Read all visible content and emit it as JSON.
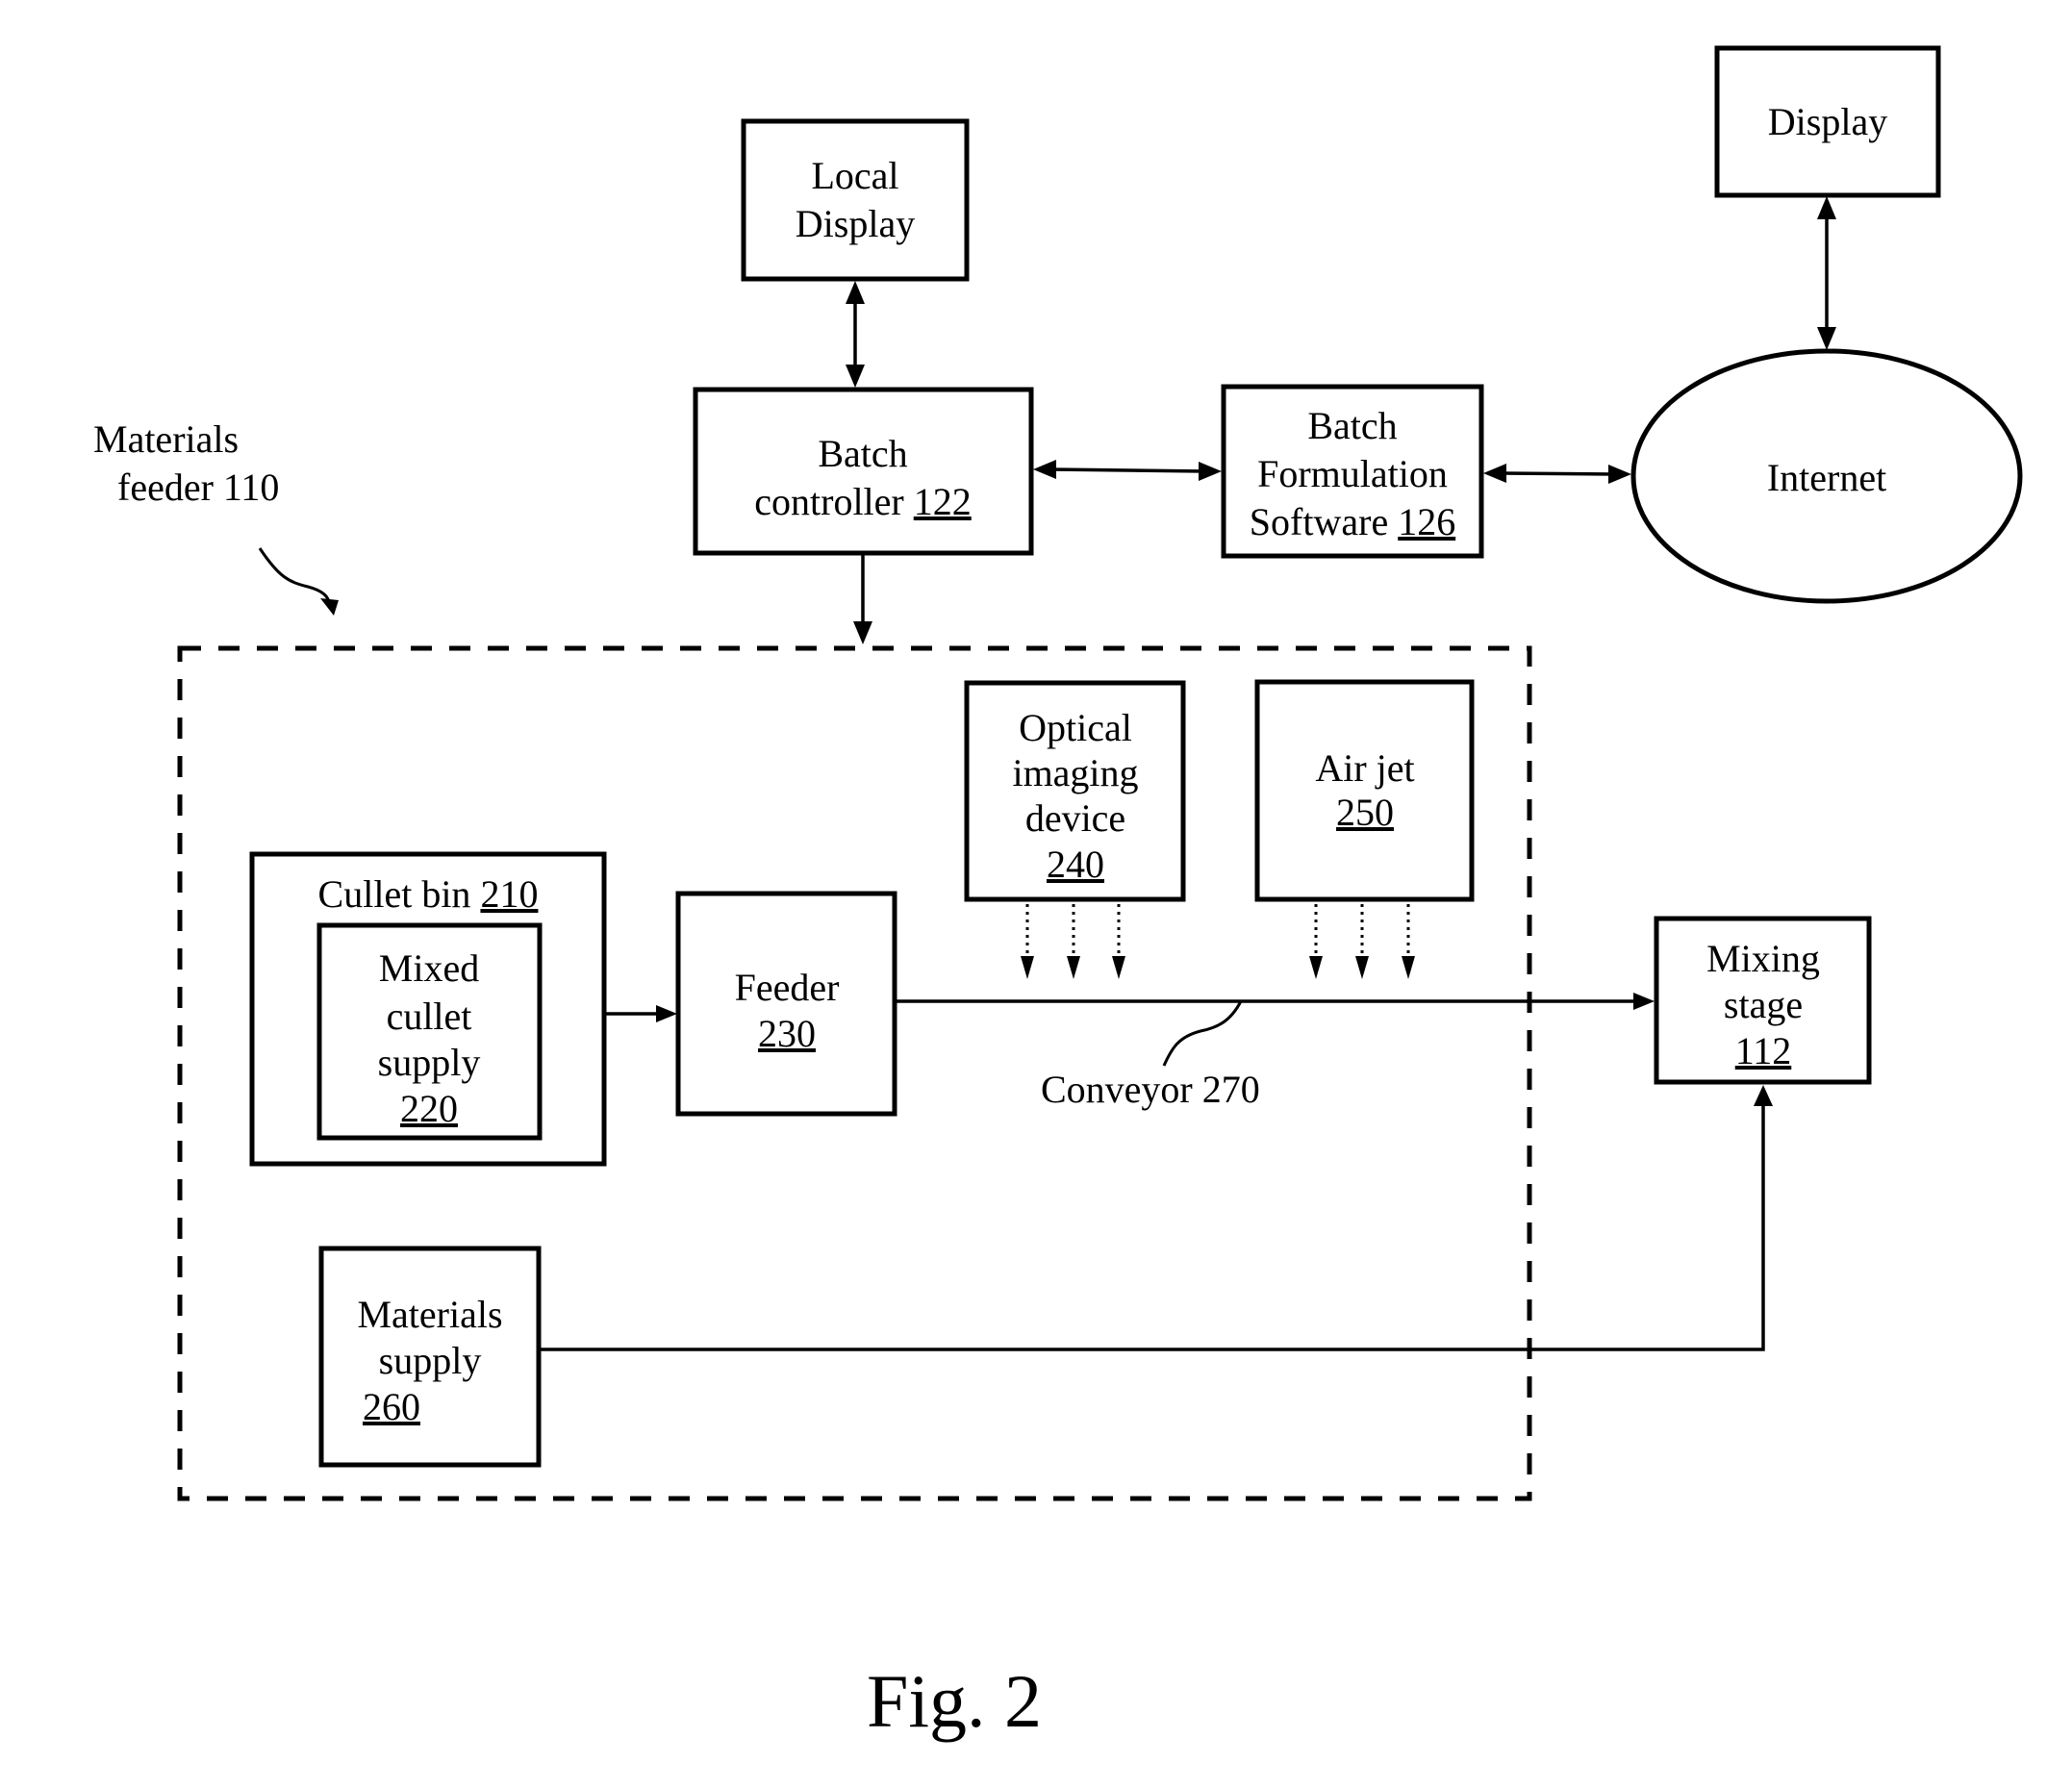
{
  "figure": {
    "caption": "Fig. 2"
  },
  "nodes": {
    "local_display": {
      "lines": [
        "Local",
        "Display"
      ]
    },
    "display": {
      "lines": [
        "Display"
      ]
    },
    "batch_controller": {
      "line1": "Batch",
      "line2_text": "controller ",
      "ref": "122"
    },
    "batch_formulation": {
      "line1": "Batch",
      "line2": "Formulation",
      "line3_text": "Software ",
      "ref": "126"
    },
    "internet": {
      "label": "Internet"
    },
    "materials_feeder": {
      "line1": "Materials",
      "line2": "feeder 110"
    },
    "cullet_bin": {
      "label_text": "Cullet bin ",
      "ref": "210"
    },
    "mixed_cullet": {
      "lines": [
        "Mixed",
        "cullet",
        "supply"
      ],
      "ref": "220"
    },
    "feeder": {
      "label": "Feeder",
      "ref": "230"
    },
    "optical": {
      "lines": [
        "Optical",
        "imaging",
        "device"
      ],
      "ref": "240"
    },
    "air_jet": {
      "label": "Air jet",
      "ref": "250"
    },
    "materials_supply": {
      "lines": [
        "Materials",
        "supply"
      ],
      "ref": "260"
    },
    "mixing_stage": {
      "lines": [
        "Mixing",
        "stage"
      ],
      "ref": "112"
    },
    "conveyor": {
      "label": "Conveyor 270"
    }
  },
  "edges": [
    {
      "from": "local_display",
      "to": "batch_controller",
      "type": "bidirectional"
    },
    {
      "from": "batch_controller",
      "to": "batch_formulation",
      "type": "bidirectional"
    },
    {
      "from": "batch_formulation",
      "to": "internet",
      "type": "bidirectional"
    },
    {
      "from": "display",
      "to": "internet",
      "type": "bidirectional"
    },
    {
      "from": "batch_controller",
      "to": "materials_feeder",
      "type": "directed"
    },
    {
      "from": "cullet_bin",
      "to": "feeder",
      "type": "directed"
    },
    {
      "from": "feeder",
      "to": "mixing_stage",
      "type": "directed",
      "via": "conveyor"
    },
    {
      "from": "optical",
      "to": "conveyor",
      "type": "dotted"
    },
    {
      "from": "air_jet",
      "to": "conveyor",
      "type": "dotted"
    },
    {
      "from": "materials_supply",
      "to": "mixing_stage",
      "type": "directed"
    }
  ]
}
